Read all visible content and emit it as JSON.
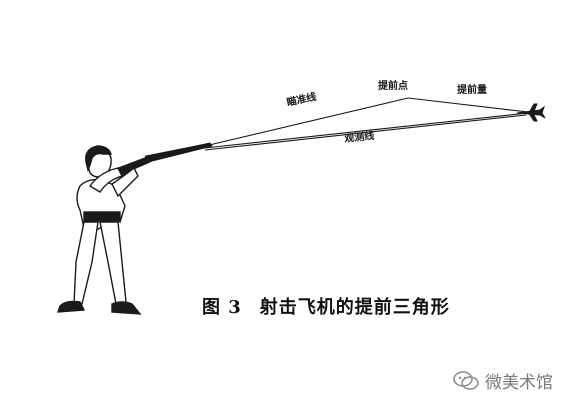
{
  "diagram": {
    "labels": {
      "aim_line": "瞄准线",
      "lead_point": "提前点",
      "lead_amount": "提前量",
      "sight_line": "观测线"
    },
    "caption": {
      "figure_number": "图 3",
      "title": "射击飞机的提前三角形"
    }
  },
  "watermark": {
    "text": "微美术馆",
    "icon": "wechat-icon"
  },
  "colors": {
    "ink": "#1a1a1a",
    "watermark": "#7a7a7a",
    "background": "#ffffff"
  }
}
